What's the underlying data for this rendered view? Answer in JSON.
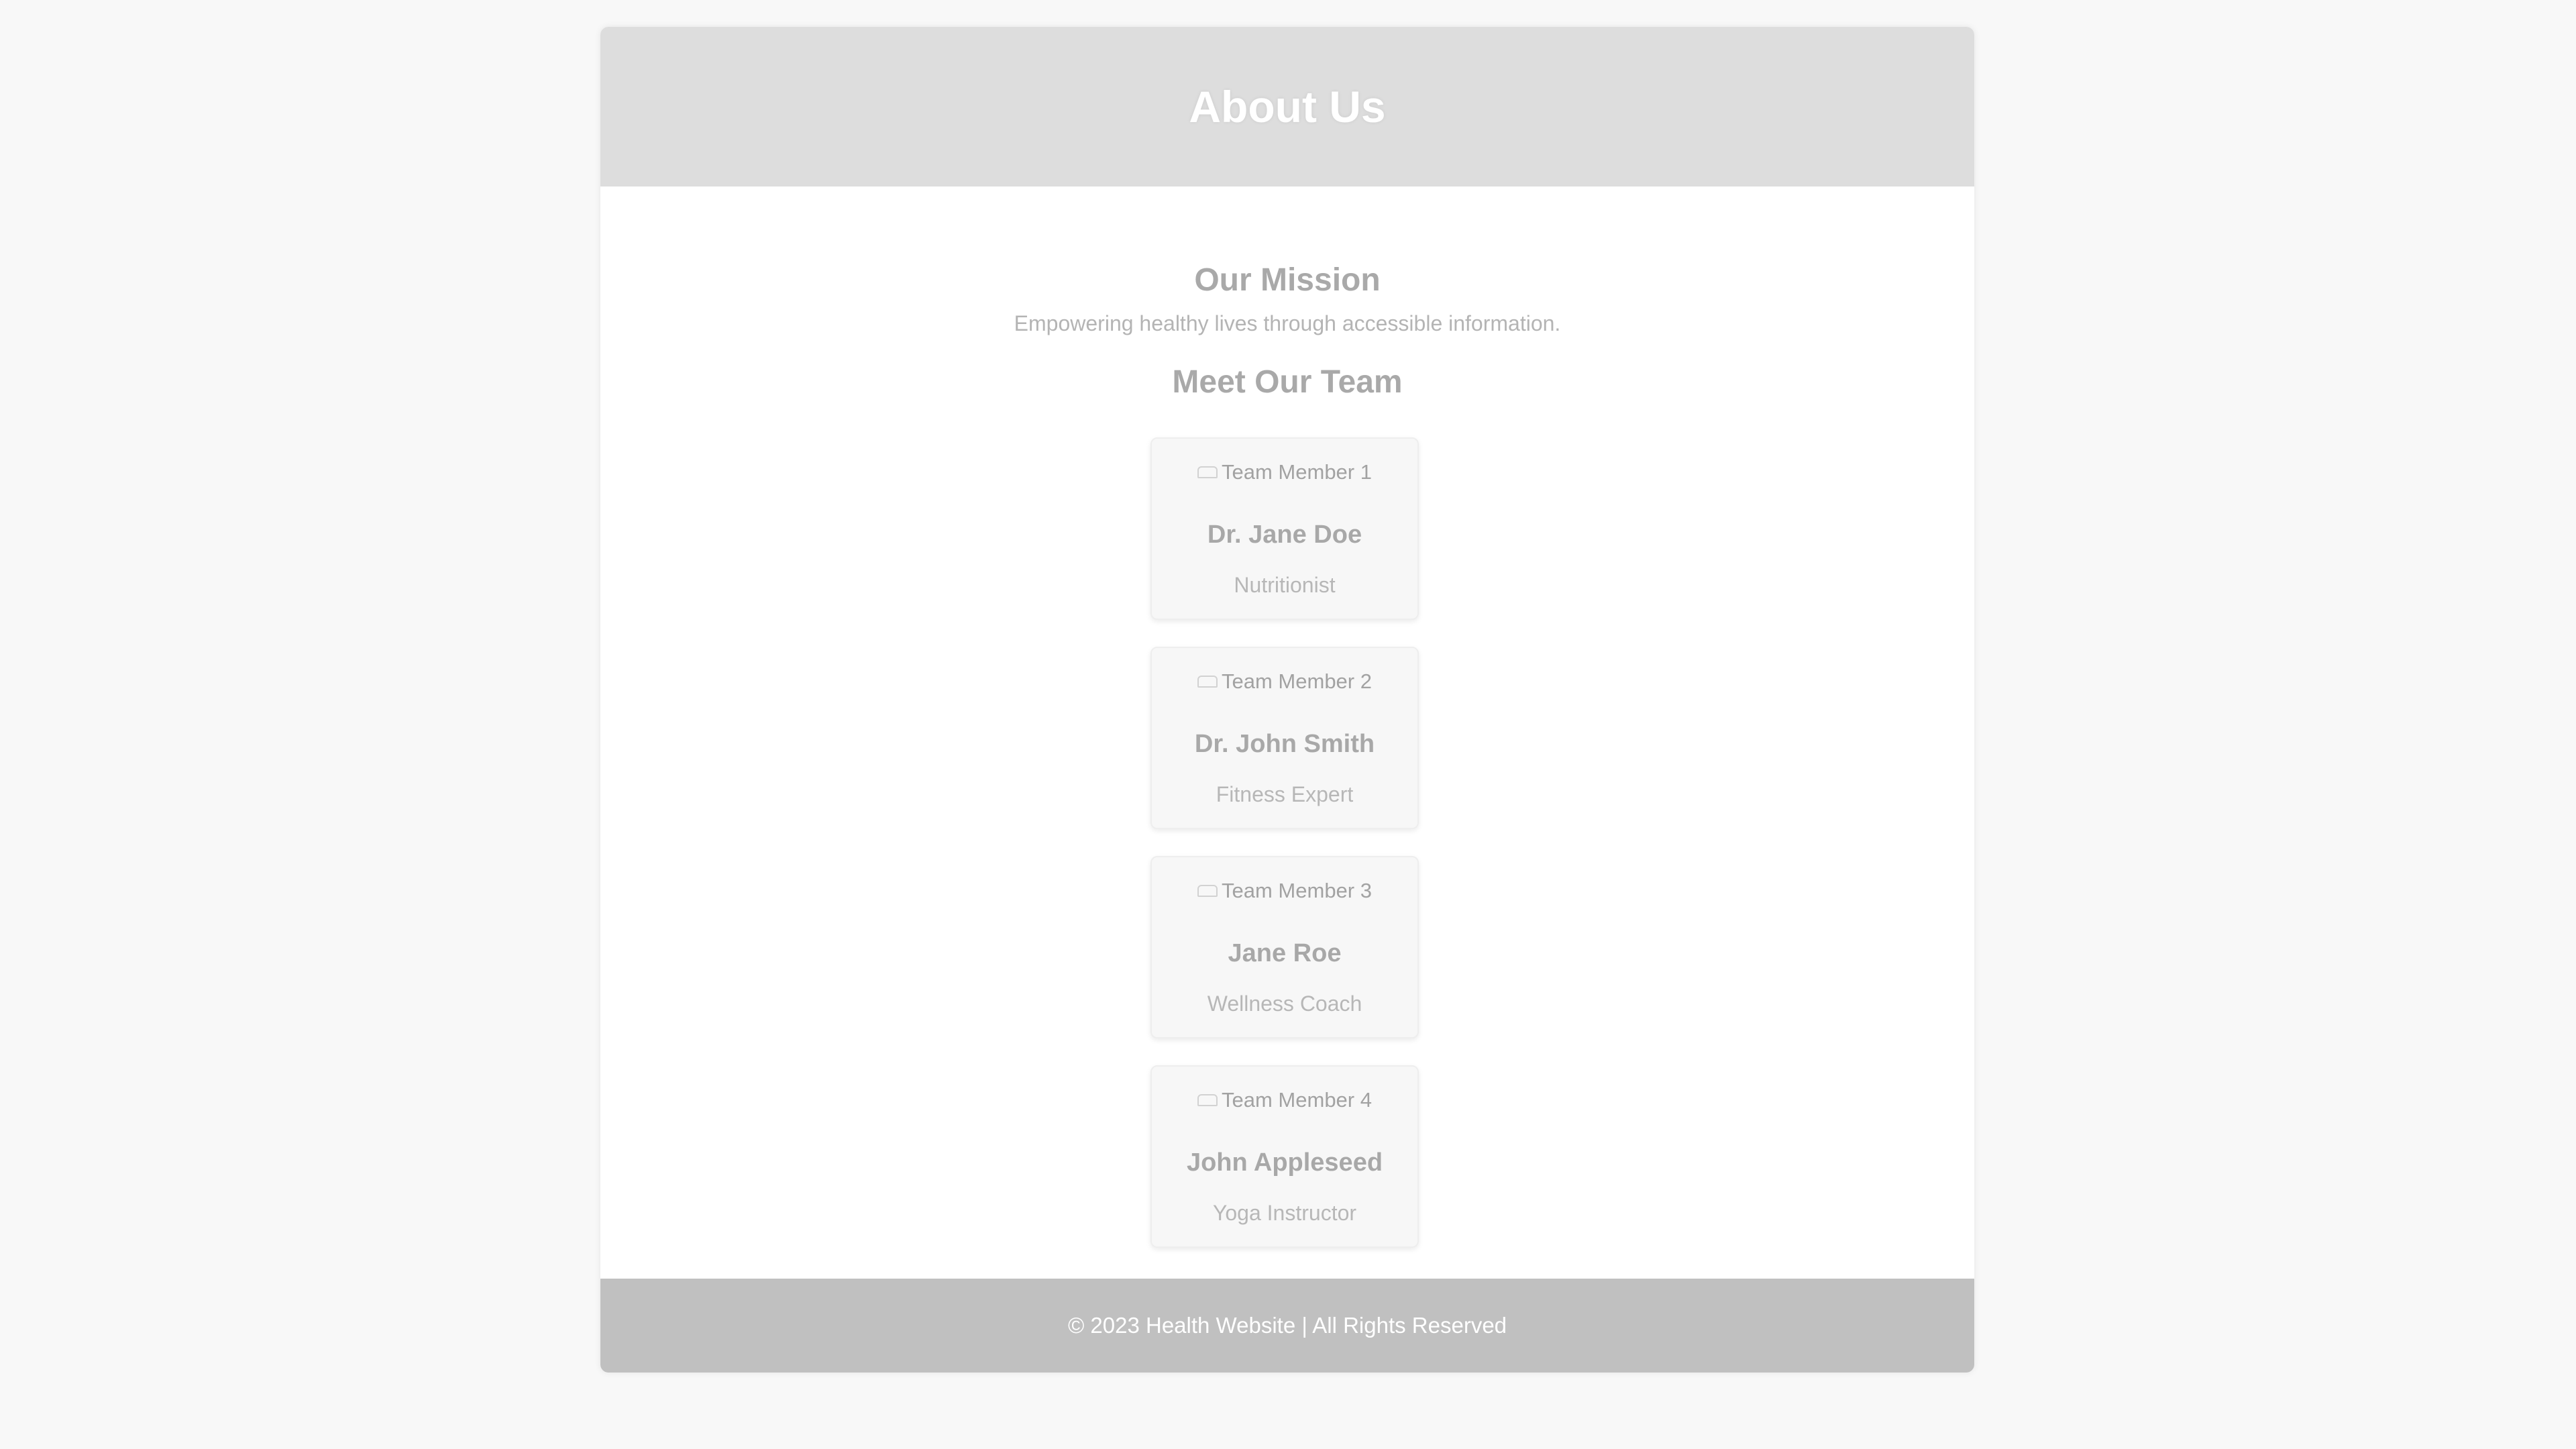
{
  "header": {
    "title": "About Us"
  },
  "mission": {
    "heading": "Our Mission",
    "text": "Empowering healthy lives through accessible information."
  },
  "team": {
    "heading": "Meet Our Team",
    "members": [
      {
        "photo_alt": "Team Member 1",
        "name": "Dr. Jane Doe",
        "role": "Nutritionist"
      },
      {
        "photo_alt": "Team Member 2",
        "name": "Dr. John Smith",
        "role": "Fitness Expert"
      },
      {
        "photo_alt": "Team Member 3",
        "name": "Jane Roe",
        "role": "Wellness Coach"
      },
      {
        "photo_alt": "Team Member 4",
        "name": "John Appleseed",
        "role": "Yoga Instructor"
      }
    ]
  },
  "footer": {
    "text": "© 2023 Health Website | All Rights Reserved"
  },
  "colors": {
    "header_bg": "#dddddd",
    "footer_bg": "#c0c0c0",
    "page_bg": "#f8f8f8"
  }
}
